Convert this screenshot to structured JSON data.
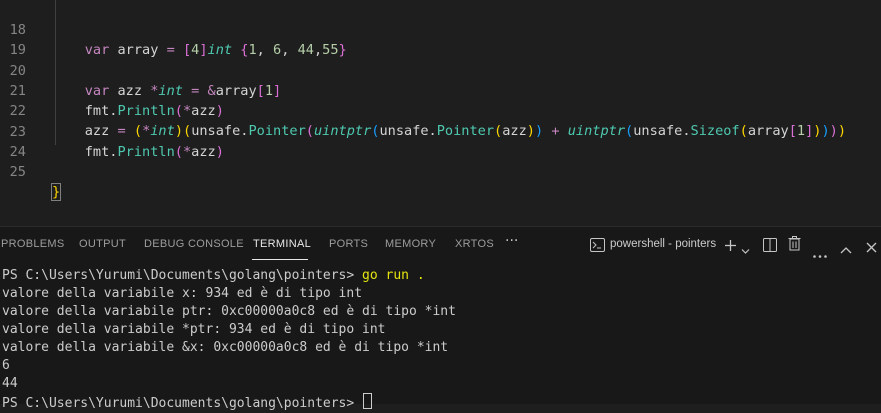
{
  "editor": {
    "lines": [
      {
        "n": "18"
      },
      {
        "n": "19"
      },
      {
        "n": "20"
      },
      {
        "n": "21"
      },
      {
        "n": "22"
      },
      {
        "n": "23"
      },
      {
        "n": "24"
      },
      {
        "n": "25"
      }
    ]
  },
  "panel": {
    "tabs": [
      "PROBLEMS",
      "OUTPUT",
      "DEBUG CONSOLE",
      "TERMINAL",
      "PORTS",
      "MEMORY",
      "XRTOS"
    ],
    "active_tab": "TERMINAL",
    "more": "···",
    "terminal_name": "powershell - pointers",
    "icons": [
      "terminal-icon",
      "add-icon",
      "chevron-down-icon",
      "split-icon",
      "trash-icon",
      "more-icon",
      "maximize-icon",
      "close-icon"
    ]
  },
  "terminal": {
    "prompt1": "PS C:\\Users\\Yurumi\\Documents\\golang\\pointers> ",
    "cmd1": "go run .",
    "out1": "valore della variabile x: 934 ed è di tipo int",
    "out2": "valore della variabile ptr: 0xc00000a0c8 ed è di tipo *int",
    "out3": "valore della variabile *ptr: 934 ed è di tipo int",
    "out4": "valore della variabile &x: 0xc00000a0c8 ed è di tipo *int",
    "out5": "6",
    "out6": "44",
    "prompt2": "PS C:\\Users\\Yurumi\\Documents\\golang\\pointers> "
  }
}
